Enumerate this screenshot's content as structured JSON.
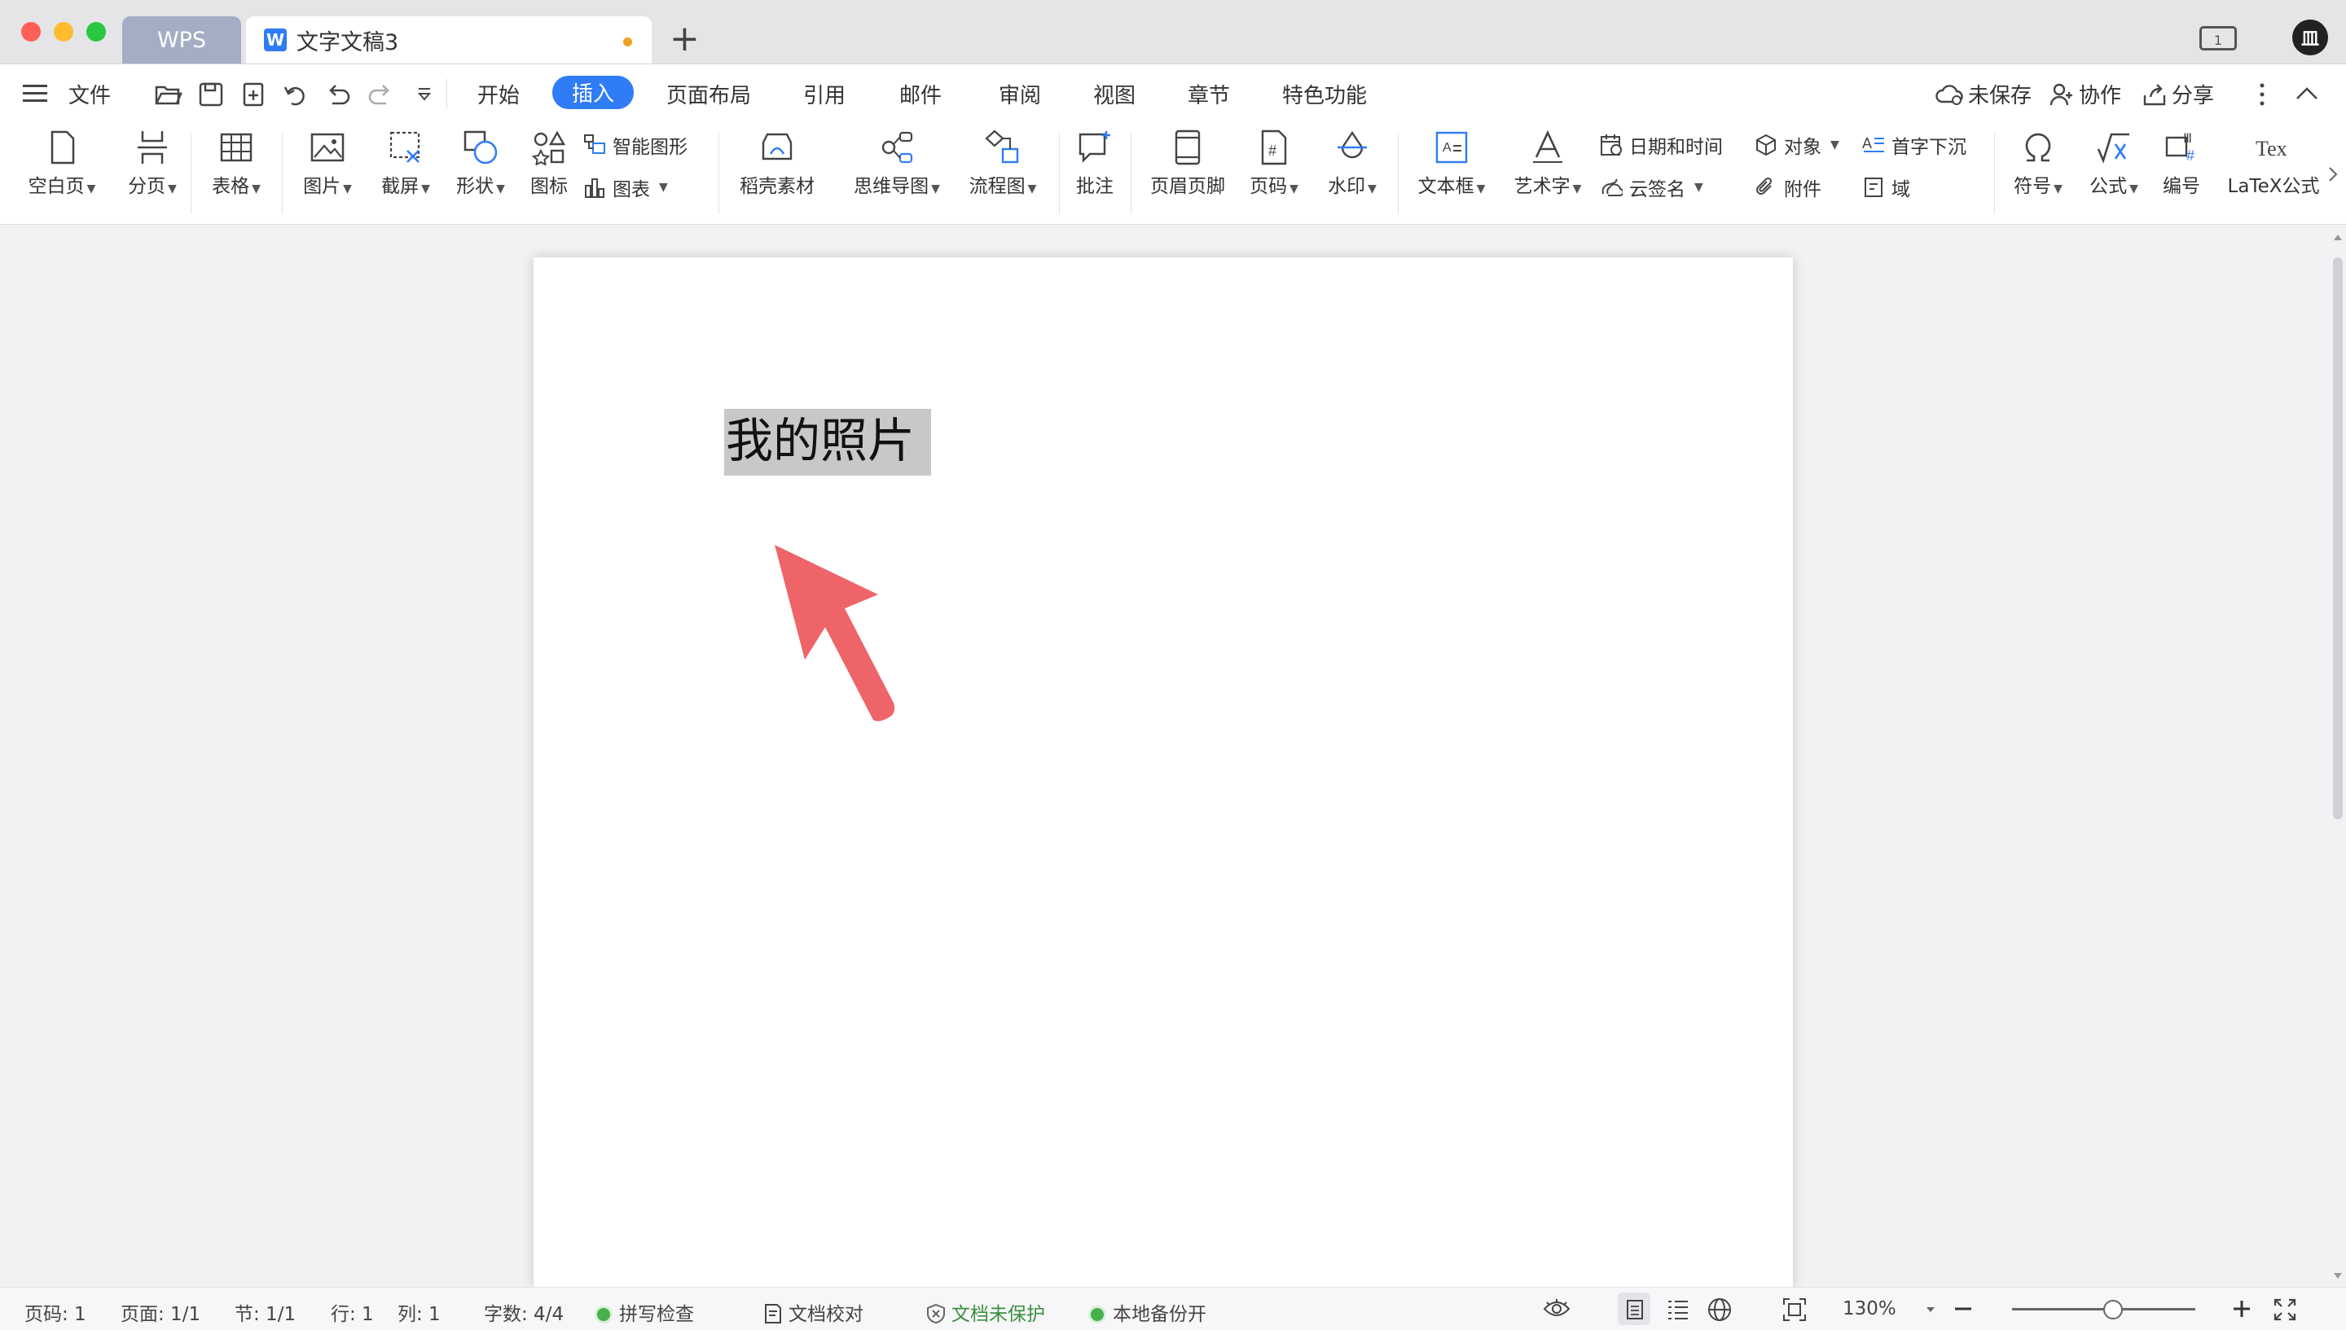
{
  "titlebar": {
    "tab_wps": "WPS",
    "tab_doc_title": "文字文稿3",
    "new_tab": "+",
    "layout_badge": "1",
    "avatar_text": "皿"
  },
  "menubar": {
    "file": "文件",
    "tabs": [
      "开始",
      "插入",
      "页面布局",
      "引用",
      "邮件",
      "审阅",
      "视图",
      "章节",
      "特色功能"
    ],
    "active_tab": "插入",
    "unsaved": "未保存",
    "collaborate": "协作",
    "share": "分享"
  },
  "ribbon": {
    "blank_page": "空白页",
    "page_break": "分页",
    "table": "表格",
    "picture": "图片",
    "screenshot": "截屏",
    "shape": "形状",
    "icon": "图标",
    "smart_graphic": "智能图形",
    "chart": "图表",
    "material": "稻壳素材",
    "mindmap": "思维导图",
    "flowchart": "流程图",
    "comment": "批注",
    "header_footer": "页眉页脚",
    "page_number": "页码",
    "watermark": "水印",
    "textbox": "文本框",
    "wordart": "艺术字",
    "date_time": "日期和时间",
    "cloud_sign": "云签名",
    "object": "对象",
    "attachment": "附件",
    "drop_cap": "首字下沉",
    "field": "域",
    "symbol": "符号",
    "formula": "公式",
    "numbering": "编号",
    "latex": "LaTeX公式"
  },
  "document": {
    "selected_text": "我的照片"
  },
  "statusbar": {
    "page_no": "页码: 1",
    "pages": "页面: 1/1",
    "section": "节: 1/1",
    "row": "行: 1",
    "col": "列: 1",
    "word_count": "字数: 4/4",
    "spell_check": "拼写检查",
    "proofread": "文档校对",
    "protection": "文档未保护",
    "backup": "本地备份开",
    "zoom": "130%"
  },
  "colors": {
    "accent": "#2f7cf6",
    "arrow": "#ee6468",
    "selection": "#c8c8c8",
    "status_green": "#46b04a"
  }
}
